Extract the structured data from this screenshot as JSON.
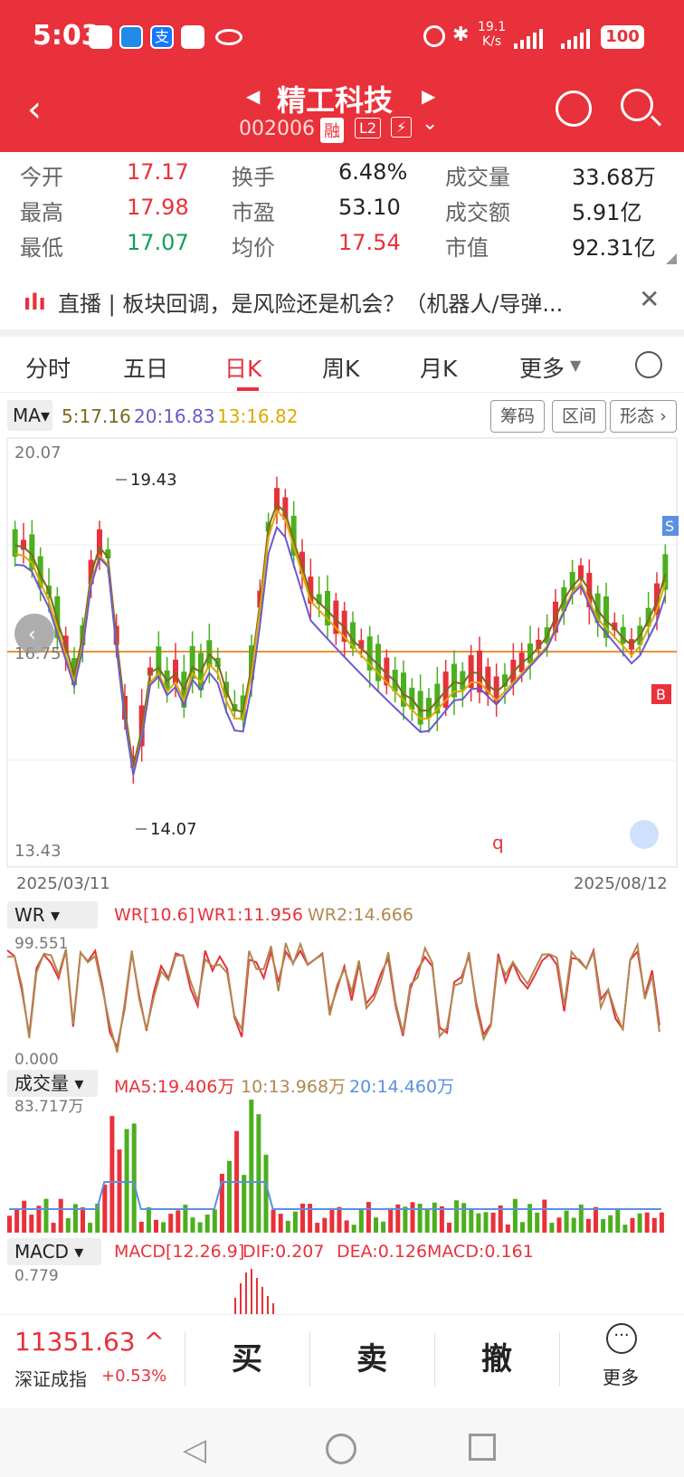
{
  "status_bar": {
    "time": "5:03",
    "net_speed_top": "19.1",
    "net_speed_bottom": "K/s",
    "battery": "100"
  },
  "header": {
    "title": "精工科技",
    "code": "002006",
    "tag_rong": "融",
    "tag_l2": "L2"
  },
  "stats": [
    {
      "label": "今开",
      "value": "17.17",
      "color": "#e8313a"
    },
    {
      "label": "换手",
      "value": "6.48%",
      "color": "#222"
    },
    {
      "label": "成交量",
      "value": "33.68万",
      "color": "#222"
    },
    {
      "label": "最高",
      "value": "17.98",
      "color": "#e8313a"
    },
    {
      "label": "市盈",
      "value": "53.10",
      "color": "#222"
    },
    {
      "label": "成交额",
      "value": "5.91亿",
      "color": "#222"
    },
    {
      "label": "最低",
      "value": "17.07",
      "color": "#12a05a"
    },
    {
      "label": "均价",
      "value": "17.54",
      "color": "#e8313a"
    },
    {
      "label": "市值",
      "value": "92.31亿",
      "color": "#222"
    }
  ],
  "news": {
    "text": "直播 | 板块回调，是风险还是机会？（机器人/导弹..."
  },
  "tabs": [
    "分时",
    "五日",
    "日K",
    "周K",
    "月K",
    "更多"
  ],
  "active_tab": "日K",
  "ma": {
    "label": "MA",
    "ma5": "5:17.16",
    "ma20": "20:16.83",
    "ma13": "13:16.82"
  },
  "pills": [
    "筹码",
    "区间",
    "形态"
  ],
  "kline": {
    "y_top": "20.07",
    "y_mid": "16.75",
    "y_bottom": "13.43",
    "high_label": "19.43",
    "low_label": "14.07",
    "date_start": "2025/03/11",
    "date_end": "2025/08/12",
    "marker_s": "S",
    "marker_b": "B"
  },
  "wr": {
    "name": "WR",
    "params": "WR[10.6]",
    "wr1": "WR1:11.956",
    "wr2": "WR2:14.666",
    "top": "99.551",
    "bottom": "0.000"
  },
  "volume": {
    "name": "成交量",
    "ma5": "MA5:19.406万",
    "ma10": "10:13.968万",
    "ma20": "20:14.460万",
    "top": "83.717万"
  },
  "macd": {
    "name": "MACD",
    "params": "MACD[12.26.9]",
    "dif": "DIF:0.207",
    "dea": "DEA:0.126",
    "macd": "MACD:0.161",
    "top": "0.779"
  },
  "index": {
    "value": "11351.63",
    "name": "深证成指",
    "change": "+0.53%"
  },
  "actions": {
    "buy": "买",
    "sell": "卖",
    "cancel": "撤",
    "more": "更多"
  },
  "colors": {
    "brand_red": "#e8313a",
    "up": "#e8313a",
    "down": "#4caf1e",
    "ma5": "#7a6a1e",
    "ma20": "#6a5acd",
    "ma13": "#e0a800"
  }
}
